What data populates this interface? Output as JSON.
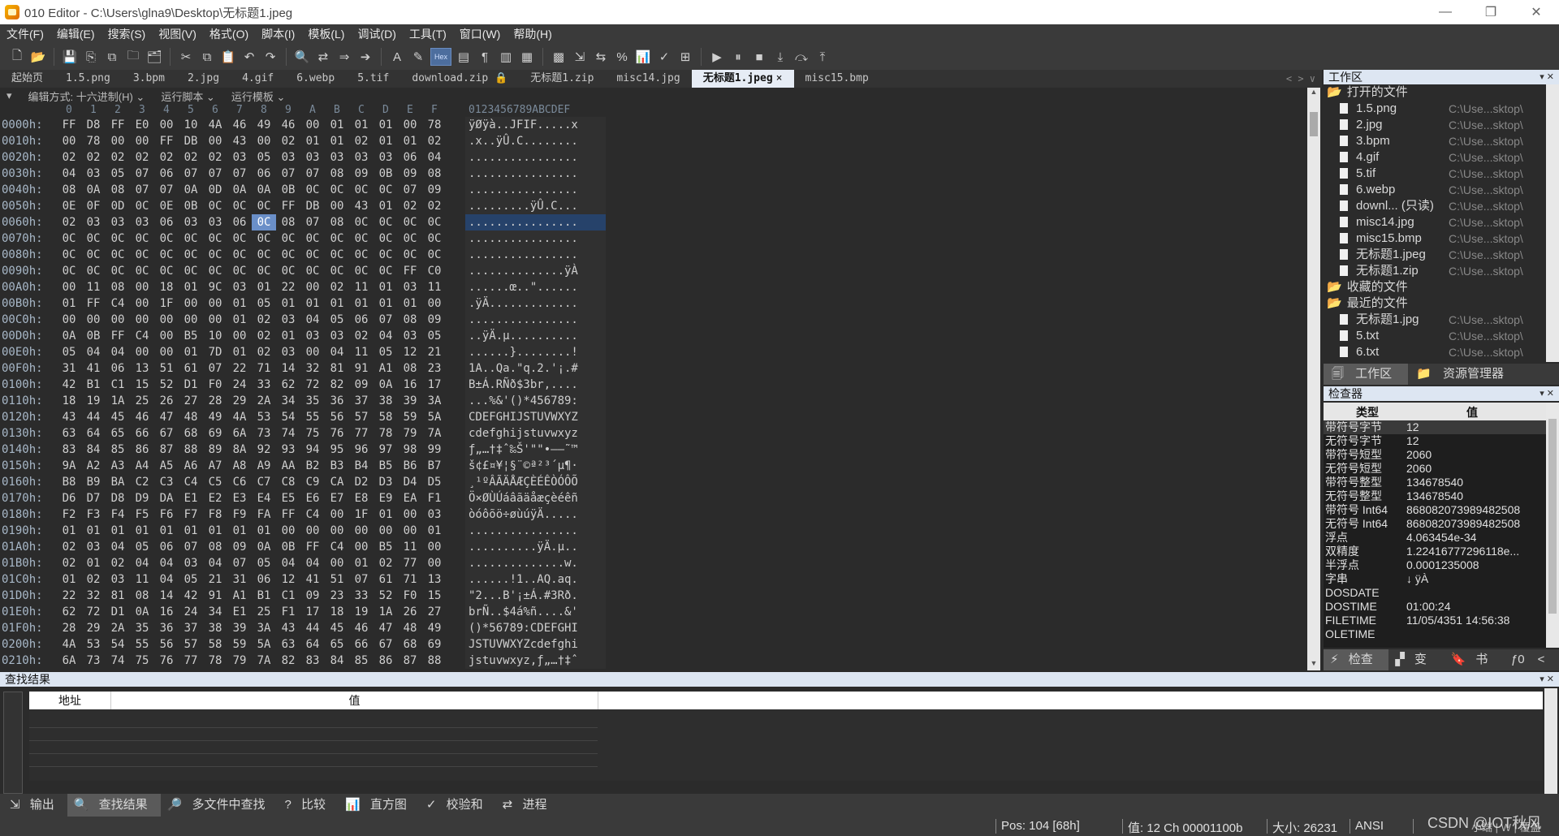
{
  "window": {
    "title": "010 Editor - C:\\Users\\glna9\\Desktop\\无标题1.jpeg",
    "min": "—",
    "max": "❐",
    "close": "✕"
  },
  "menu": [
    "文件(F)",
    "编辑(E)",
    "搜索(S)",
    "视图(V)",
    "格式(O)",
    "脚本(I)",
    "模板(L)",
    "调试(D)",
    "工具(T)",
    "窗口(W)",
    "帮助(H)"
  ],
  "tabs": [
    "起始页",
    "1.5.png",
    "3.bpm",
    "2.jpg",
    "4.gif",
    "6.webp",
    "5.tif",
    "download.zip",
    "无标题1.zip",
    "misc14.jpg",
    "无标题1.jpeg",
    "misc15.bmp"
  ],
  "active_tab_index": 10,
  "tab_close": "×",
  "tab_nav": "< > ∨",
  "editor_options": {
    "edit_mode": "编辑方式: 十六进制(H) ⌄",
    "run_script": "运行脚本 ⌄",
    "run_template": "运行模板 ⌄"
  },
  "hex": {
    "col_labels": [
      "0",
      "1",
      "2",
      "3",
      "4",
      "5",
      "6",
      "7",
      "8",
      "9",
      "A",
      "B",
      "C",
      "D",
      "E",
      "F"
    ],
    "char_header": "0123456789ABCDEF",
    "current_row": "0060h:",
    "current_col": 8,
    "rows": [
      {
        "addr": "0000h:",
        "bytes": [
          "FF",
          "D8",
          "FF",
          "E0",
          "00",
          "10",
          "4A",
          "46",
          "49",
          "46",
          "00",
          "01",
          "01",
          "01",
          "00",
          "78"
        ],
        "chars": "ÿØÿà..JFIF.....x"
      },
      {
        "addr": "0010h:",
        "bytes": [
          "00",
          "78",
          "00",
          "00",
          "FF",
          "DB",
          "00",
          "43",
          "00",
          "02",
          "01",
          "01",
          "02",
          "01",
          "01",
          "02"
        ],
        "chars": ".x..ÿÛ.C........"
      },
      {
        "addr": "0020h:",
        "bytes": [
          "02",
          "02",
          "02",
          "02",
          "02",
          "02",
          "02",
          "03",
          "05",
          "03",
          "03",
          "03",
          "03",
          "03",
          "06",
          "04"
        ],
        "chars": "................"
      },
      {
        "addr": "0030h:",
        "bytes": [
          "04",
          "03",
          "05",
          "07",
          "06",
          "07",
          "07",
          "07",
          "06",
          "07",
          "07",
          "08",
          "09",
          "0B",
          "09",
          "08"
        ],
        "chars": "................"
      },
      {
        "addr": "0040h:",
        "bytes": [
          "08",
          "0A",
          "08",
          "07",
          "07",
          "0A",
          "0D",
          "0A",
          "0A",
          "0B",
          "0C",
          "0C",
          "0C",
          "0C",
          "07",
          "09"
        ],
        "chars": "................"
      },
      {
        "addr": "0050h:",
        "bytes": [
          "0E",
          "0F",
          "0D",
          "0C",
          "0E",
          "0B",
          "0C",
          "0C",
          "0C",
          "FF",
          "DB",
          "00",
          "43",
          "01",
          "02",
          "02"
        ],
        "chars": ".........ÿÛ.C..."
      },
      {
        "addr": "0060h:",
        "bytes": [
          "02",
          "03",
          "03",
          "03",
          "06",
          "03",
          "03",
          "06",
          "0C",
          "08",
          "07",
          "08",
          "0C",
          "0C",
          "0C",
          "0C"
        ],
        "chars": "................"
      },
      {
        "addr": "0070h:",
        "bytes": [
          "0C",
          "0C",
          "0C",
          "0C",
          "0C",
          "0C",
          "0C",
          "0C",
          "0C",
          "0C",
          "0C",
          "0C",
          "0C",
          "0C",
          "0C",
          "0C"
        ],
        "chars": "................"
      },
      {
        "addr": "0080h:",
        "bytes": [
          "0C",
          "0C",
          "0C",
          "0C",
          "0C",
          "0C",
          "0C",
          "0C",
          "0C",
          "0C",
          "0C",
          "0C",
          "0C",
          "0C",
          "0C",
          "0C"
        ],
        "chars": "................"
      },
      {
        "addr": "0090h:",
        "bytes": [
          "0C",
          "0C",
          "0C",
          "0C",
          "0C",
          "0C",
          "0C",
          "0C",
          "0C",
          "0C",
          "0C",
          "0C",
          "0C",
          "0C",
          "FF",
          "C0"
        ],
        "chars": "..............ÿÀ"
      },
      {
        "addr": "00A0h:",
        "bytes": [
          "00",
          "11",
          "08",
          "00",
          "18",
          "01",
          "9C",
          "03",
          "01",
          "22",
          "00",
          "02",
          "11",
          "01",
          "03",
          "11"
        ],
        "chars": "......œ..\"......"
      },
      {
        "addr": "00B0h:",
        "bytes": [
          "01",
          "FF",
          "C4",
          "00",
          "1F",
          "00",
          "00",
          "01",
          "05",
          "01",
          "01",
          "01",
          "01",
          "01",
          "01",
          "00"
        ],
        "chars": ".ÿÄ............."
      },
      {
        "addr": "00C0h:",
        "bytes": [
          "00",
          "00",
          "00",
          "00",
          "00",
          "00",
          "00",
          "01",
          "02",
          "03",
          "04",
          "05",
          "06",
          "07",
          "08",
          "09"
        ],
        "chars": "................"
      },
      {
        "addr": "00D0h:",
        "bytes": [
          "0A",
          "0B",
          "FF",
          "C4",
          "00",
          "B5",
          "10",
          "00",
          "02",
          "01",
          "03",
          "03",
          "02",
          "04",
          "03",
          "05"
        ],
        "chars": "..ÿÄ.µ.........."
      },
      {
        "addr": "00E0h:",
        "bytes": [
          "05",
          "04",
          "04",
          "00",
          "00",
          "01",
          "7D",
          "01",
          "02",
          "03",
          "00",
          "04",
          "11",
          "05",
          "12",
          "21"
        ],
        "chars": "......}........!"
      },
      {
        "addr": "00F0h:",
        "bytes": [
          "31",
          "41",
          "06",
          "13",
          "51",
          "61",
          "07",
          "22",
          "71",
          "14",
          "32",
          "81",
          "91",
          "A1",
          "08",
          "23"
        ],
        "chars": "1A..Qa.\"q.2.'¡.#"
      },
      {
        "addr": "0100h:",
        "bytes": [
          "42",
          "B1",
          "C1",
          "15",
          "52",
          "D1",
          "F0",
          "24",
          "33",
          "62",
          "72",
          "82",
          "09",
          "0A",
          "16",
          "17"
        ],
        "chars": "B±Á.RÑð$3br,...."
      },
      {
        "addr": "0110h:",
        "bytes": [
          "18",
          "19",
          "1A",
          "25",
          "26",
          "27",
          "28",
          "29",
          "2A",
          "34",
          "35",
          "36",
          "37",
          "38",
          "39",
          "3A"
        ],
        "chars": "...%&'()*456789:"
      },
      {
        "addr": "0120h:",
        "bytes": [
          "43",
          "44",
          "45",
          "46",
          "47",
          "48",
          "49",
          "4A",
          "53",
          "54",
          "55",
          "56",
          "57",
          "58",
          "59",
          "5A"
        ],
        "chars": "CDEFGHIJSTUVWXYZ"
      },
      {
        "addr": "0130h:",
        "bytes": [
          "63",
          "64",
          "65",
          "66",
          "67",
          "68",
          "69",
          "6A",
          "73",
          "74",
          "75",
          "76",
          "77",
          "78",
          "79",
          "7A"
        ],
        "chars": "cdefghijstuvwxyz"
      },
      {
        "addr": "0140h:",
        "bytes": [
          "83",
          "84",
          "85",
          "86",
          "87",
          "88",
          "89",
          "8A",
          "92",
          "93",
          "94",
          "95",
          "96",
          "97",
          "98",
          "99"
        ],
        "chars": "ƒ„…†‡ˆ‰Š'\"\"•–—˜™"
      },
      {
        "addr": "0150h:",
        "bytes": [
          "9A",
          "A2",
          "A3",
          "A4",
          "A5",
          "A6",
          "A7",
          "A8",
          "A9",
          "AA",
          "B2",
          "B3",
          "B4",
          "B5",
          "B6",
          "B7"
        ],
        "chars": "š¢£¤¥¦§¨©ª²³´µ¶·"
      },
      {
        "addr": "0160h:",
        "bytes": [
          "B8",
          "B9",
          "BA",
          "C2",
          "C3",
          "C4",
          "C5",
          "C6",
          "C7",
          "C8",
          "C9",
          "CA",
          "D2",
          "D3",
          "D4",
          "D5"
        ],
        "chars": "¸¹ºÂÃÄÅÆÇÈÉÊÒÓÔÕ"
      },
      {
        "addr": "0170h:",
        "bytes": [
          "D6",
          "D7",
          "D8",
          "D9",
          "DA",
          "E1",
          "E2",
          "E3",
          "E4",
          "E5",
          "E6",
          "E7",
          "E8",
          "E9",
          "EA",
          "F1"
        ],
        "chars": "Ö×ØÙÚáâãäåæçèéêñ"
      },
      {
        "addr": "0180h:",
        "bytes": [
          "F2",
          "F3",
          "F4",
          "F5",
          "F6",
          "F7",
          "F8",
          "F9",
          "FA",
          "FF",
          "C4",
          "00",
          "1F",
          "01",
          "00",
          "03"
        ],
        "chars": "òóôõö÷øùúÿÄ....."
      },
      {
        "addr": "0190h:",
        "bytes": [
          "01",
          "01",
          "01",
          "01",
          "01",
          "01",
          "01",
          "01",
          "01",
          "00",
          "00",
          "00",
          "00",
          "00",
          "00",
          "01"
        ],
        "chars": "................"
      },
      {
        "addr": "01A0h:",
        "bytes": [
          "02",
          "03",
          "04",
          "05",
          "06",
          "07",
          "08",
          "09",
          "0A",
          "0B",
          "FF",
          "C4",
          "00",
          "B5",
          "11",
          "00"
        ],
        "chars": "..........ÿÄ.µ.."
      },
      {
        "addr": "01B0h:",
        "bytes": [
          "02",
          "01",
          "02",
          "04",
          "04",
          "03",
          "04",
          "07",
          "05",
          "04",
          "04",
          "00",
          "01",
          "02",
          "77",
          "00"
        ],
        "chars": "..............w."
      },
      {
        "addr": "01C0h:",
        "bytes": [
          "01",
          "02",
          "03",
          "11",
          "04",
          "05",
          "21",
          "31",
          "06",
          "12",
          "41",
          "51",
          "07",
          "61",
          "71",
          "13"
        ],
        "chars": "......!1..AQ.aq."
      },
      {
        "addr": "01D0h:",
        "bytes": [
          "22",
          "32",
          "81",
          "08",
          "14",
          "42",
          "91",
          "A1",
          "B1",
          "C1",
          "09",
          "23",
          "33",
          "52",
          "F0",
          "15"
        ],
        "chars": "\"2...B'¡±Á.#3Rð."
      },
      {
        "addr": "01E0h:",
        "bytes": [
          "62",
          "72",
          "D1",
          "0A",
          "16",
          "24",
          "34",
          "E1",
          "25",
          "F1",
          "17",
          "18",
          "19",
          "1A",
          "26",
          "27"
        ],
        "chars": "brÑ..$4á%ñ....&'"
      },
      {
        "addr": "01F0h:",
        "bytes": [
          "28",
          "29",
          "2A",
          "35",
          "36",
          "37",
          "38",
          "39",
          "3A",
          "43",
          "44",
          "45",
          "46",
          "47",
          "48",
          "49"
        ],
        "chars": "()*56789:CDEFGHI"
      },
      {
        "addr": "0200h:",
        "bytes": [
          "4A",
          "53",
          "54",
          "55",
          "56",
          "57",
          "58",
          "59",
          "5A",
          "63",
          "64",
          "65",
          "66",
          "67",
          "68",
          "69"
        ],
        "chars": "JSTUVWXYZcdefghi"
      },
      {
        "addr": "0210h:",
        "bytes": [
          "6A",
          "73",
          "74",
          "75",
          "76",
          "77",
          "78",
          "79",
          "7A",
          "82",
          "83",
          "84",
          "85",
          "86",
          "87",
          "88"
        ],
        "chars": "jstuvwxyz,ƒ„…†‡ˆ"
      }
    ]
  },
  "workspace": {
    "title": "工作区",
    "open_files_label": "打开的文件",
    "files": [
      {
        "name": "1.5.png",
        "path": "C:\\Use...sktop\\"
      },
      {
        "name": "2.jpg",
        "path": "C:\\Use...sktop\\"
      },
      {
        "name": "3.bpm",
        "path": "C:\\Use...sktop\\"
      },
      {
        "name": "4.gif",
        "path": "C:\\Use...sktop\\"
      },
      {
        "name": "5.tif",
        "path": "C:\\Use...sktop\\"
      },
      {
        "name": "6.webp",
        "path": "C:\\Use...sktop\\"
      },
      {
        "name": "downl... (只读)",
        "path": "C:\\Use...sktop\\"
      },
      {
        "name": "misc14.jpg",
        "path": "C:\\Use...sktop\\"
      },
      {
        "name": "misc15.bmp",
        "path": "C:\\Use...sktop\\"
      },
      {
        "name": "无标题1.jpeg",
        "path": "C:\\Use...sktop\\"
      },
      {
        "name": "无标题1.zip",
        "path": "C:\\Use...sktop\\"
      }
    ],
    "favorites_label": "收藏的文件",
    "recent_label": "最近的文件",
    "recent": [
      {
        "name": "无标题1.jpg",
        "path": "C:\\Use...sktop\\"
      },
      {
        "name": "5.txt",
        "path": "C:\\Use...sktop\\"
      },
      {
        "name": "6.txt",
        "path": "C:\\Use...sktop\\"
      }
    ],
    "tab_workspace": "工作区",
    "tab_explorer": "资源管理器"
  },
  "inspector": {
    "title": "检查器",
    "col_type": "类型",
    "col_value": "值",
    "rows": [
      {
        "k": "带符号字节",
        "v": "12"
      },
      {
        "k": "无符号字节",
        "v": "12"
      },
      {
        "k": "带符号短型",
        "v": "2060"
      },
      {
        "k": "无符号短型",
        "v": "2060"
      },
      {
        "k": "带符号整型",
        "v": "134678540"
      },
      {
        "k": "无符号整型",
        "v": "134678540"
      },
      {
        "k": "带符号 Int64",
        "v": "868082073989482508"
      },
      {
        "k": "无符号 Int64",
        "v": "868082073989482508"
      },
      {
        "k": "浮点",
        "v": "4.063454e-34"
      },
      {
        "k": "双精度",
        "v": "1.22416777296118e..."
      },
      {
        "k": "半浮点",
        "v": "0.0001235008"
      },
      {
        "k": "字串",
        "v": "↓ ÿÀ"
      },
      {
        "k": "DOSDATE",
        "v": ""
      },
      {
        "k": "DOSTIME",
        "v": "01:00:24"
      },
      {
        "k": "FILETIME",
        "v": "11/05/4351 14:56:38"
      },
      {
        "k": "OLETIME",
        "v": ""
      }
    ],
    "tabs": [
      "检查器",
      "变量",
      "书签",
      "ƒ0",
      "< >"
    ]
  },
  "results": {
    "title": "查找结果",
    "col_addr": "地址",
    "col_value": "值"
  },
  "bottom_tabs": [
    "输出",
    "查找结果",
    "多文件中查找",
    "比较",
    "直方图",
    "校验和",
    "进程"
  ],
  "status": {
    "pos": "Pos: 104 [68h]",
    "value": "值: 12 Ch 00001100b",
    "size": "大小: 26231",
    "encoding": "ANSI",
    "mode": "小端 | W | 覆盖"
  },
  "watermark": "CSDN @IOT秋风"
}
